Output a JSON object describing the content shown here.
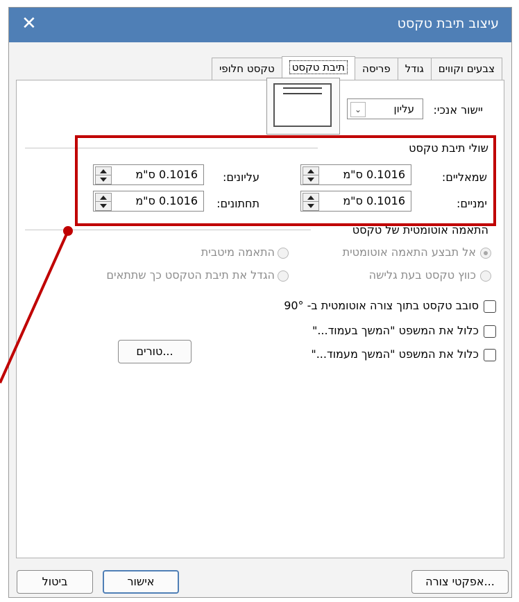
{
  "window": {
    "title": "עיצוב תיבת טקסט",
    "close_glyph": "✕"
  },
  "tabs": [
    {
      "label": "צבעים וקווים",
      "active": false
    },
    {
      "label": "גודל",
      "active": false
    },
    {
      "label": "פריסה",
      "active": false
    },
    {
      "label": "תיבת טקסט",
      "active": true
    },
    {
      "label": "טקסט חלופי",
      "active": false
    }
  ],
  "vertical_alignment": {
    "label": "יישור אנכי:",
    "value": "עליון"
  },
  "margins": {
    "title": "שולי תיבת טקסט",
    "left": {
      "label": "שמאליים:",
      "value": "0.1016 ס\"מ"
    },
    "top": {
      "label": "עליונים:",
      "value": "0.1016 ס\"מ"
    },
    "right": {
      "label": "ימניים:",
      "value": "0.1016 ס\"מ"
    },
    "bottom": {
      "label": "תחתונים:",
      "value": "0.1016 ס\"מ"
    }
  },
  "autofit": {
    "title": "התאמה אוטומטית של טקסט",
    "no_autofit": "אל תבצע התאמה אוטומטית",
    "best_fit": "התאמה מיטבית",
    "shrink_on_overflow": "כווץ טקסט בעת גלישה",
    "grow_box": "הגדל את תיבת הטקסט כך שתתאים"
  },
  "options": {
    "rotate_text": "סובב טקסט בתוך צורה אוטומטית ב- 90°",
    "continued_on": "כלול את המשפט \"המשך בעמוד...\"",
    "continued_from": "כלול את המשפט \"המשך מעמוד...\"",
    "columns_button": "טורים..."
  },
  "footer": {
    "shape_effects": "אפקטי צורה...",
    "ok": "אישור",
    "cancel": "ביטול"
  },
  "colors": {
    "titlebar": "#4f7fb6",
    "callout": "#c00000",
    "dialog_bg": "#f3f3f3"
  },
  "icons": {
    "close": "close-icon",
    "dropdown": "chevron-down-icon",
    "spinner": "spinner-arrows-icon"
  }
}
